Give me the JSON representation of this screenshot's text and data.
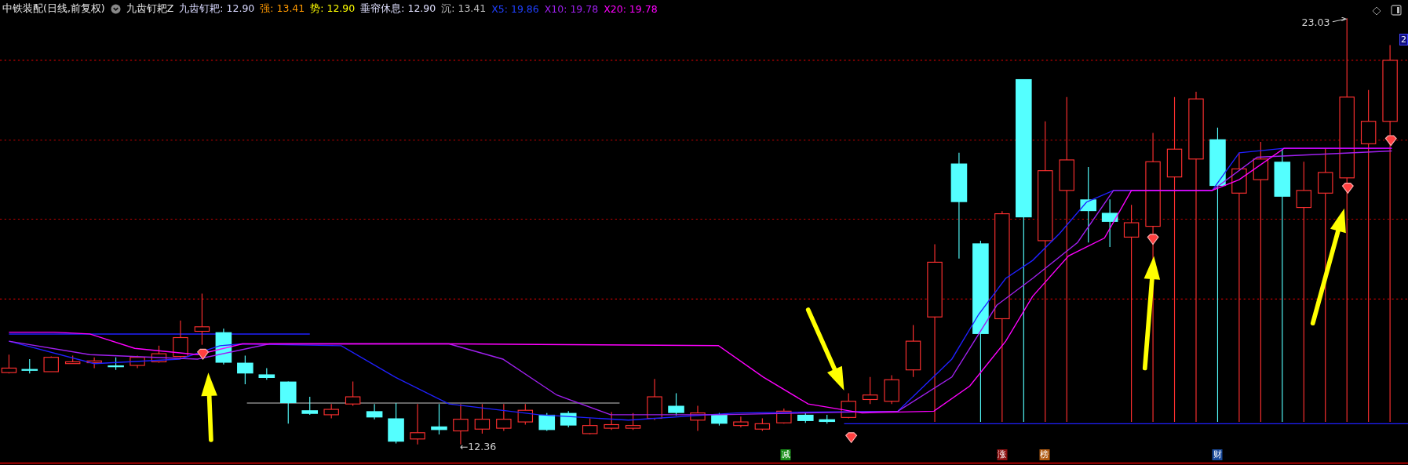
{
  "header": {
    "title": "中铁装配(日线,前复权)",
    "indicator_name": "九齿钉耙Z",
    "readings": [
      {
        "label": "九齿钉耙:",
        "value": "12.90",
        "color": "#d8d8ff"
      },
      {
        "label": "强:",
        "value": "13.41",
        "color": "#ff9900"
      },
      {
        "label": "势:",
        "value": "12.90",
        "color": "#ffff00"
      },
      {
        "label": "垂帘休息:",
        "value": "12.90",
        "color": "#e0e0ff"
      },
      {
        "label": "沉:",
        "value": "13.41",
        "color": "#c0c0c0"
      },
      {
        "label": "X5:",
        "value": "19.86",
        "color": "#2040ff"
      },
      {
        "label": "X10:",
        "value": "19.78",
        "color": "#a020f0"
      },
      {
        "label": "X20:",
        "value": "19.78",
        "color": "#ff00ff"
      }
    ]
  },
  "chart": {
    "high_label": "23.03",
    "low_label": "←12.36",
    "axis_tag": "2",
    "signal_badges": [
      {
        "text": "减",
        "color": "#1a8f1a"
      },
      {
        "text": "涨",
        "color": "#8b1010"
      },
      {
        "text": "榜",
        "color": "#b05a10"
      },
      {
        "text": "财",
        "color": "#1a4a9a"
      }
    ]
  }
}
